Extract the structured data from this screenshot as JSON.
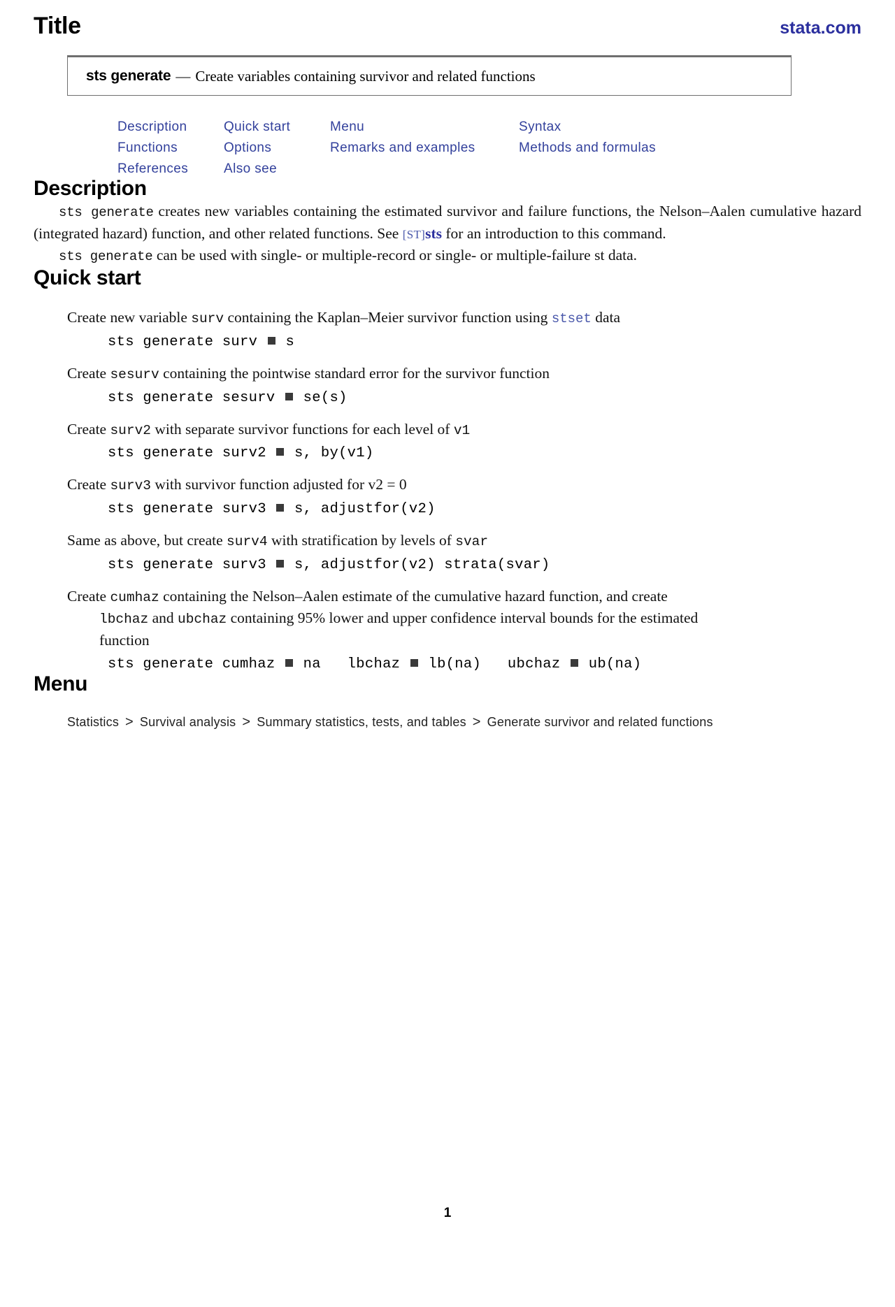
{
  "header": {
    "title": "Title",
    "stata_link": "stata.com"
  },
  "titlebox": {
    "command": "sts generate",
    "dash": "—",
    "description": "Create variables containing survivor and related functions"
  },
  "nav_links": [
    {
      "label": "Description"
    },
    {
      "label": "Quick start"
    },
    {
      "label": "Menu"
    },
    {
      "label": "Syntax"
    },
    {
      "label": "Functions"
    },
    {
      "label": "Options"
    },
    {
      "label": "Remarks and examples"
    },
    {
      "label": "Methods and formulas"
    },
    {
      "label": "References"
    },
    {
      "label": "Also see"
    }
  ],
  "sections": {
    "description": {
      "heading": "Description",
      "para1_a": "sts generate",
      "para1_b": " creates new variables containing the estimated survivor and failure functions, the Nelson–Aalen cumulative hazard (integrated hazard) function, and other related functions. See ",
      "para1_ref_bracket": "[ST]",
      "para1_ref_cmd": "sts",
      "para1_c": " for an introduction to this command.",
      "para2_a": "sts generate",
      "para2_b": " can be used with single- or multiple-record or single- or multiple-failure st data."
    },
    "quick_start": {
      "heading": "Quick start",
      "items": [
        {
          "text_before": "Create new variable ",
          "var1": "surv",
          "text_mid": " containing the Kaplan–Meier survivor function using ",
          "link": "stset",
          "text_after": " data",
          "code_pre": "sts generate surv ",
          "code_post": " s"
        },
        {
          "text_before": "Create ",
          "var1": "sesurv",
          "text_mid": " containing the pointwise standard error for the survivor function",
          "link": "",
          "text_after": "",
          "code_pre": "sts generate sesurv ",
          "code_post": " se(s)"
        },
        {
          "text_before": "Create ",
          "var1": "surv2",
          "text_mid": " with separate survivor functions for each level of ",
          "link": "",
          "text_after": "",
          "var2": "v1",
          "code_pre": "sts generate surv2 ",
          "code_post": " s, by(v1)"
        },
        {
          "text_before": "Create ",
          "var1": "surv3",
          "text_mid": " with survivor function adjusted for ",
          "math": "v2 = 0",
          "text_after": "",
          "code_pre": "sts generate surv3 ",
          "code_post": " s, adjustfor(v2)"
        },
        {
          "text_before": "Same as above, but create ",
          "var1": "surv4",
          "text_mid": " with stratification by levels of ",
          "var2": "svar",
          "text_after": "",
          "code_pre": "sts generate surv3 ",
          "code_post": " s, adjustfor(v2) strata(svar)"
        },
        {
          "text_before": "Create ",
          "var1": "cumhaz",
          "text_mid": " containing the Nelson–Aalen estimate of the cumulative hazard function, and create",
          "cont_var1": "lbchaz",
          "cont_mid": " and ",
          "cont_var2": "ubchaz",
          "cont_after": " containing 95% lower and upper confidence interval bounds for the estimated",
          "cont_line3": "function",
          "code_pre": "sts generate cumhaz ",
          "code_mid1": " na   lbchaz ",
          "code_mid2": " lb(na)   ubchaz ",
          "code_post": " ub(na)"
        }
      ]
    },
    "menu": {
      "heading": "Menu",
      "breadcrumb": [
        "Statistics",
        "Survival analysis",
        "Summary statistics, tests, and tables",
        "Generate survivor and related functions"
      ],
      "separator": ">"
    }
  },
  "footer": {
    "page_number": "1"
  },
  "colors": {
    "link_blue": "#33419c",
    "brand_blue": "#2b2f9e",
    "text": "#000000"
  }
}
